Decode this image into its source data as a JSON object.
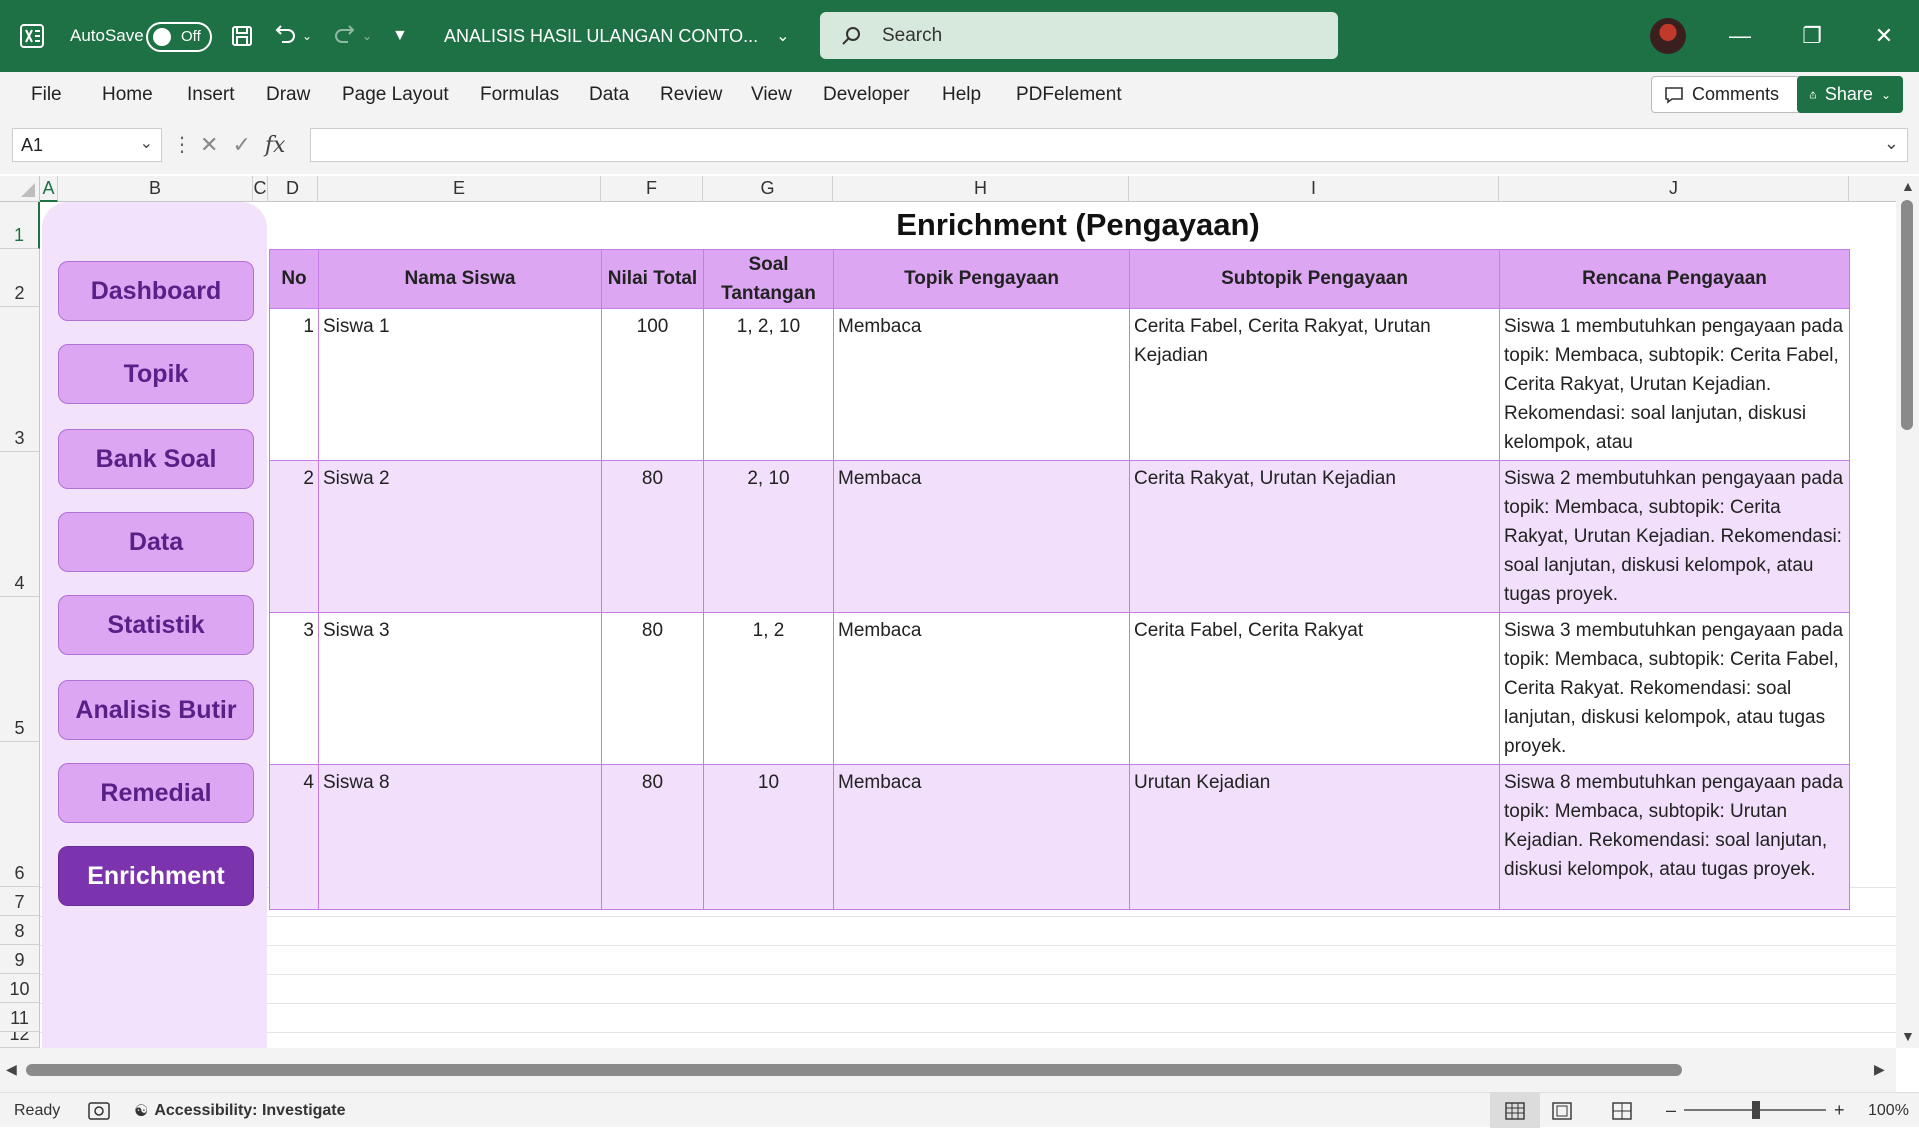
{
  "titlebar": {
    "autosave_label": "AutoSave",
    "autosave_state": "Off",
    "doc_title": "ANALISIS HASIL ULANGAN CONTO...",
    "search_placeholder": "Search",
    "accent": "#1e7145"
  },
  "ribbon": {
    "tabs": [
      "File",
      "Home",
      "Insert",
      "Draw",
      "Page Layout",
      "Formulas",
      "Data",
      "Review",
      "View",
      "Developer",
      "Help",
      "PDFelement"
    ],
    "comments_label": "Comments",
    "share_label": "Share"
  },
  "formula_bar": {
    "name_box": "A1",
    "formula": ""
  },
  "columns": [
    "A",
    "B",
    "C",
    "D",
    "E",
    "F",
    "G",
    "H",
    "I",
    "J"
  ],
  "rows": [
    "1",
    "2",
    "3",
    "4",
    "5",
    "6",
    "7",
    "8",
    "9",
    "10",
    "11",
    "12"
  ],
  "sidebar": {
    "items": [
      "Dashboard",
      "Topik",
      "Bank Soal",
      "Data",
      "Statistik",
      "Analisis Butir",
      "Remedial",
      "Enrichment"
    ],
    "active": "Enrichment",
    "button_color": "#dca6f3",
    "active_color": "#7b34ad"
  },
  "table": {
    "title": "Enrichment (Pengayaan)",
    "headers": [
      "No",
      "Nama Siswa",
      "Nilai Total",
      "Soal Tantangan",
      "Topik Pengayaan",
      "Subtopik Pengayaan",
      "Rencana Pengayaan"
    ],
    "rows": [
      [
        "1",
        "Siswa 1",
        "100",
        "1, 2, 10",
        "Membaca",
        "Cerita Fabel, Cerita Rakyat, Urutan Kejadian",
        "Siswa 1 membutuhkan pengayaan pada topik: Membaca, subtopik: Cerita Fabel, Cerita Rakyat, Urutan Kejadian. Rekomendasi: soal lanjutan, diskusi kelompok, atau"
      ],
      [
        "2",
        "Siswa 2",
        "80",
        "2, 10",
        "Membaca",
        "Cerita Rakyat, Urutan Kejadian",
        "Siswa 2 membutuhkan pengayaan pada topik: Membaca, subtopik: Cerita Rakyat, Urutan Kejadian. Rekomendasi: soal lanjutan, diskusi kelompok, atau tugas proyek."
      ],
      [
        "3",
        "Siswa 3",
        "80",
        "1, 2",
        "Membaca",
        "Cerita Fabel, Cerita Rakyat",
        "Siswa 3 membutuhkan pengayaan pada topik: Membaca, subtopik: Cerita Fabel, Cerita Rakyat. Rekomendasi: soal lanjutan, diskusi kelompok, atau tugas proyek."
      ],
      [
        "4",
        "Siswa 8",
        "80",
        "10",
        "Membaca",
        "Urutan Kejadian",
        "Siswa 8 membutuhkan pengayaan pada topik: Membaca, subtopik: Urutan Kejadian. Rekomendasi: soal lanjutan, diskusi kelompok, atau tugas proyek."
      ]
    ],
    "header_color": "#dca6f3",
    "band_color": "#f1dffb"
  },
  "statusbar": {
    "ready": "Ready",
    "accessibility": "Accessibility: Investigate",
    "zoom": "100%"
  }
}
